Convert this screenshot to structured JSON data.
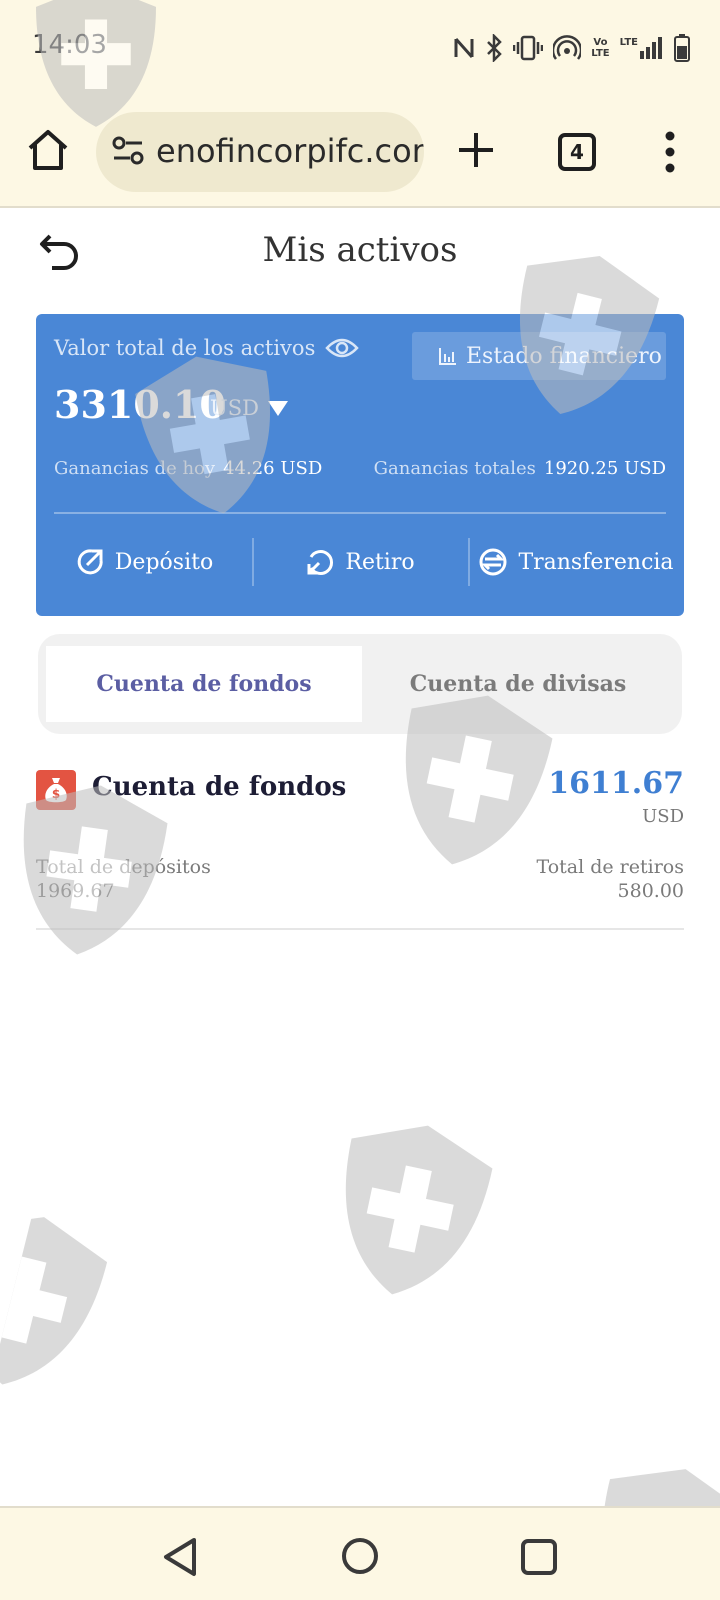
{
  "status_bar": {
    "time": "14:03",
    "icons": [
      "nfc-icon",
      "bluetooth-icon",
      "vibrate-icon",
      "hotspot-icon",
      "volte-icon",
      "lte-signal-icon",
      "battery-icon"
    ],
    "volte_top": "Vo",
    "volte_bottom": "LTE",
    "lte_label": "LTE"
  },
  "browser": {
    "url": "enofincorpifc.com",
    "tab_count": "4"
  },
  "header": {
    "title": "Mis activos"
  },
  "asset_card": {
    "total_label": "Valor total de los activos",
    "statement_button": "Estado financiero",
    "total_amount": "3310.10",
    "currency": "USD",
    "today_label": "Ganancias de hoy",
    "today_value": "44.26 USD",
    "total_earnings_label": "Ganancias totales",
    "total_earnings_value": "1920.25 USD",
    "actions": [
      {
        "label": "Depósito",
        "icon": "deposit-icon"
      },
      {
        "label": "Retiro",
        "icon": "withdraw-icon"
      },
      {
        "label": "Transferencia",
        "icon": "transfer-icon"
      }
    ],
    "color": "#4a87d6"
  },
  "tabs": [
    {
      "label": "Cuenta de fondos",
      "active": true
    },
    {
      "label": "Cuenta de divisas",
      "active": false
    }
  ],
  "fund_account": {
    "title": "Cuenta de fondos",
    "balance": "1611.67",
    "currency": "USD",
    "deposits_label": "Total de depósitos",
    "deposits_value": "1969.67",
    "withdrawals_label": "Total de retiros",
    "withdrawals_value": "580.00",
    "balance_color": "#3f7fd2",
    "icon_color": "#e35442"
  },
  "nav_bar": {
    "icons": [
      "back-triangle-icon",
      "home-circle-icon",
      "recents-square-icon"
    ]
  }
}
